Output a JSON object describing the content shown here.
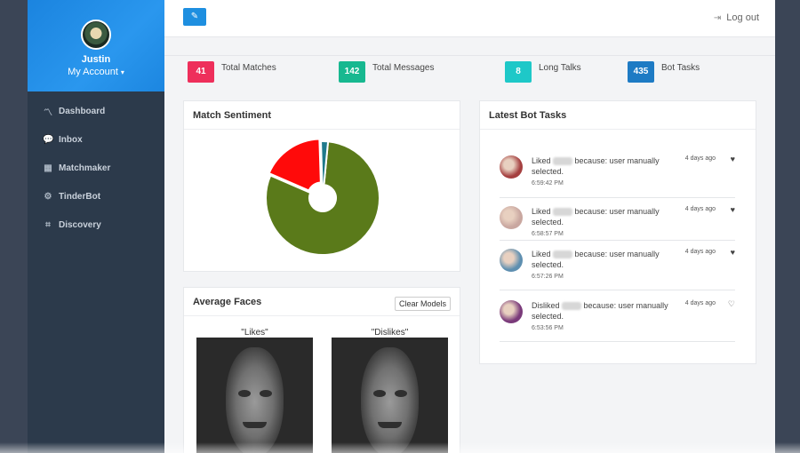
{
  "profile": {
    "name": "Justin",
    "account_label": "My Account",
    "caret": "▾"
  },
  "nav": [
    {
      "label": "Dashboard",
      "icon": "chart-line-icon",
      "glyph": "〽"
    },
    {
      "label": "Inbox",
      "icon": "chat-bubbles-icon",
      "glyph": "💬"
    },
    {
      "label": "Matchmaker",
      "icon": "matchmaker-icon",
      "glyph": "▦"
    },
    {
      "label": "TinderBot",
      "icon": "cogs-icon",
      "glyph": "⚙"
    },
    {
      "label": "Discovery",
      "icon": "binoculars-icon",
      "glyph": "⌗"
    }
  ],
  "topbar": {
    "logout_label": "Log out",
    "logout_glyph": "⇥",
    "action_glyph": "✎"
  },
  "stats": [
    {
      "value": "41",
      "label": "Total Matches",
      "color": "#ee2f5b"
    },
    {
      "value": "142",
      "label": "Total Messages",
      "color": "#17b890"
    },
    {
      "value": "8",
      "label": "Long Talks",
      "color": "#1ec8c8"
    },
    {
      "value": "435",
      "label": "Bot Tasks",
      "color": "#1e7bc4"
    }
  ],
  "sentiment": {
    "title": "Match Sentiment",
    "chart_data": {
      "type": "pie",
      "donut": true,
      "values": [
        80,
        18,
        2
      ],
      "colors": [
        "#5a7a1a",
        "#ff0a0a",
        "#1f7a8c"
      ]
    }
  },
  "faces": {
    "title": "Average Faces",
    "clear_label": "Clear Models",
    "likes_label": "\"Likes\"",
    "dislikes_label": "\"Dislikes\""
  },
  "bot_tasks": {
    "title": "Latest Bot Tasks",
    "items": [
      {
        "action": "Liked",
        "reason": "because: user manually selected.",
        "time": "6:59:42 PM",
        "ago": "4 days ago",
        "heart": "♥",
        "avatar": "#a54040"
      },
      {
        "action": "Liked",
        "reason": "because: user manually selected.",
        "time": "6:58:57 PM",
        "ago": "4 days ago",
        "heart": "♥",
        "avatar": "#c9a7a0"
      },
      {
        "action": "Liked",
        "reason": "because: user manually selected.",
        "time": "6:57:26 PM",
        "ago": "4 days ago",
        "heart": "♥",
        "avatar": "#5e8fb0"
      },
      {
        "action": "Disliked",
        "reason": "because: user manually selected.",
        "time": "6:53:56 PM",
        "ago": "4 days ago",
        "heart": "♡",
        "avatar": "#7a3a7a"
      }
    ]
  }
}
